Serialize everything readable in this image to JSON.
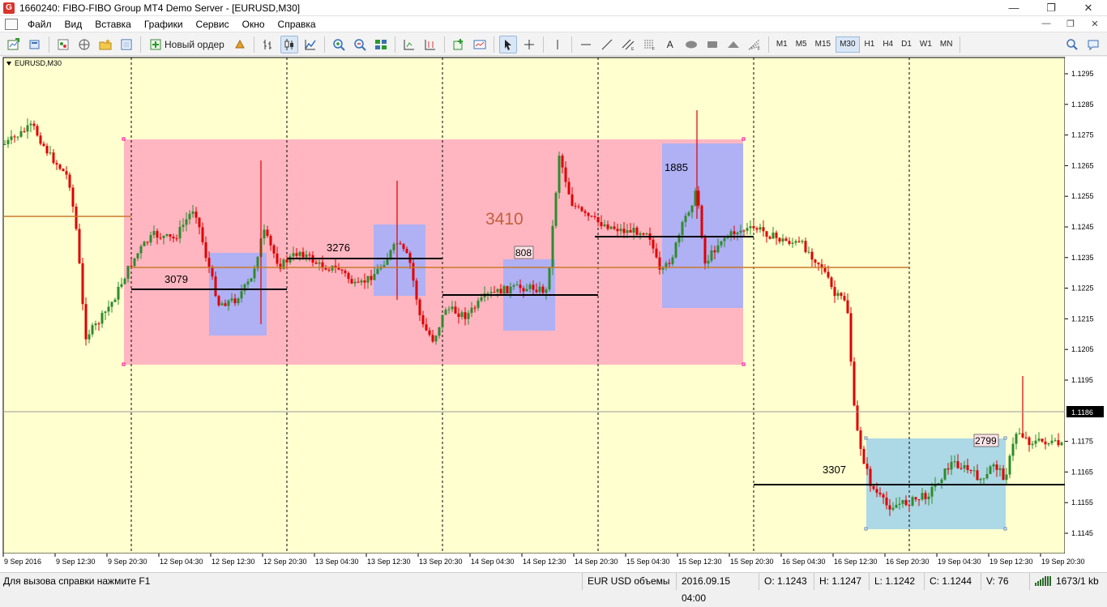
{
  "window": {
    "title": "1660240: FIBO-FIBO Group MT4 Demo Server - [EURUSD,M30]",
    "minimize": "—",
    "maximize": "❐",
    "close": "✕"
  },
  "menu": [
    "Файл",
    "Вид",
    "Вставка",
    "Графики",
    "Сервис",
    "Окно",
    "Справка"
  ],
  "toolbar": {
    "new_order_label": "Новый ордер",
    "timeframes": [
      "M1",
      "M5",
      "M15",
      "M30",
      "H1",
      "H4",
      "D1",
      "W1",
      "MN"
    ],
    "active_timeframe": "M30"
  },
  "chart": {
    "symbol_label": "EURUSD,M30",
    "background": "#ffffd0",
    "price_axis": [
      "1.1295",
      "1.1285",
      "1.1275",
      "1.1265",
      "1.1255",
      "1.1245",
      "1.1235",
      "1.1225",
      "1.1215",
      "1.1205",
      "1.1195",
      "1.1186",
      "1.1175",
      "1.1165",
      "1.1155",
      "1.1145"
    ],
    "current_price": "1.1186",
    "time_axis": [
      "9 Sep 2016",
      "9 Sep 12:30",
      "9 Sep 20:30",
      "12 Sep 04:30",
      "12 Sep 12:30",
      "12 Sep 20:30",
      "13 Sep 04:30",
      "13 Sep 12:30",
      "13 Sep 20:30",
      "14 Sep 04:30",
      "14 Sep 12:30",
      "14 Sep 20:30",
      "15 Sep 04:30",
      "15 Sep 12:30",
      "15 Sep 20:30",
      "16 Sep 04:30",
      "16 Sep 12:30",
      "16 Sep 20:30",
      "19 Sep 04:30",
      "19 Sep 12:30",
      "19 Sep 20:30"
    ],
    "annotations": {
      "big_box_volume": "3410",
      "v3079": "3079",
      "v3276": "3276",
      "v808": "808",
      "v1885": "1885",
      "v3307": "3307",
      "v2799": "2799"
    },
    "colors": {
      "pink_box": "#ffb6c1",
      "blue_box": "#b0b0f4",
      "light_blue_box": "#add8e6",
      "up_candle": "#2e8b2e",
      "down_candle": "#e00000",
      "orange_line": "#c8782a"
    }
  },
  "status": {
    "help": "Для вызова справки нажмите F1",
    "profile": "EUR USD объемы",
    "datetime": "2016.09.15 04:00",
    "open": "O: 1.1243",
    "high": "H: 1.1247",
    "low": "L: 1.1242",
    "close": "C: 1.1244",
    "volume": "V: 76",
    "traffic": "1673/1 kb"
  }
}
